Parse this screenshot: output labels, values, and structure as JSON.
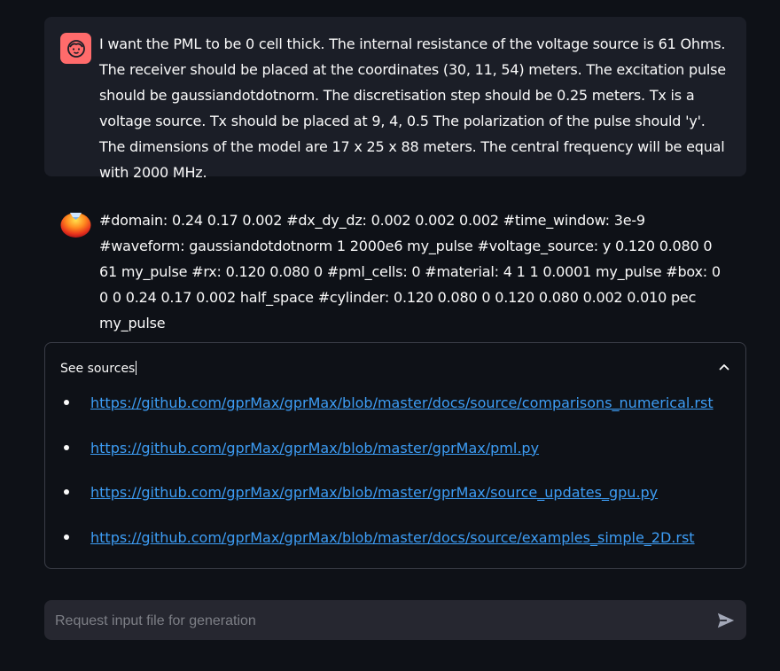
{
  "conversation": {
    "user_message": "I want the PML to be 0 cell thick. The internal resistance of the voltage source is 61 Ohms. The receiver should be placed at the coordinates (30, 11, 54) meters. The excitation pulse should be gaussiandotdotnorm. The discretisation step should be 0.25 meters. Tx is a voltage source. Tx should be placed at 9, 4, 0.5 The polarization of the pulse should 'y'. The dimensions of the model are 17 x 25 x 88 meters. The central frequency will be equal with 2000 MHz.",
    "assistant_message": "#domain: 0.24 0.17 0.002 #dx_dy_dz: 0.002 0.002 0.002 #time_window: 3e-9 #waveform: gaussiandotdotnorm 1 2000e6 my_pulse #voltage_source: y 0.120 0.080 0 61 my_pulse #rx: 0.120 0.080 0 #pml_cells: 0 #material: 4 1 1 0.0001 my_pulse #box: 0 0 0 0.24 0.17 0.002 half_space #cylinder: 0.120 0.080 0 0.120 0.080 0.002 0.010 pec my_pulse"
  },
  "sources": {
    "title": "See sources",
    "links": [
      "https://github.com/gprMax/gprMax/blob/master/docs/source/comparisons_numerical.rst",
      "https://github.com/gprMax/gprMax/blob/master/gprMax/pml.py",
      "https://github.com/gprMax/gprMax/blob/master/gprMax/source_updates_gpu.py",
      "https://github.com/gprMax/gprMax/blob/master/docs/source/examples_simple_2D.rst"
    ]
  },
  "chat_input": {
    "placeholder": "Request input file for generation",
    "value": ""
  },
  "icons": {
    "user_avatar": "face-icon",
    "assistant_avatar": "colored-ball-icon",
    "collapse": "chevron-up-icon",
    "send": "paper-plane-icon"
  },
  "colors": {
    "background": "#0e1117",
    "user_message_bg": "#1b1e27",
    "user_avatar_bg": "#ff6b6b",
    "link": "#3d9df5",
    "input_bg": "#262730"
  }
}
